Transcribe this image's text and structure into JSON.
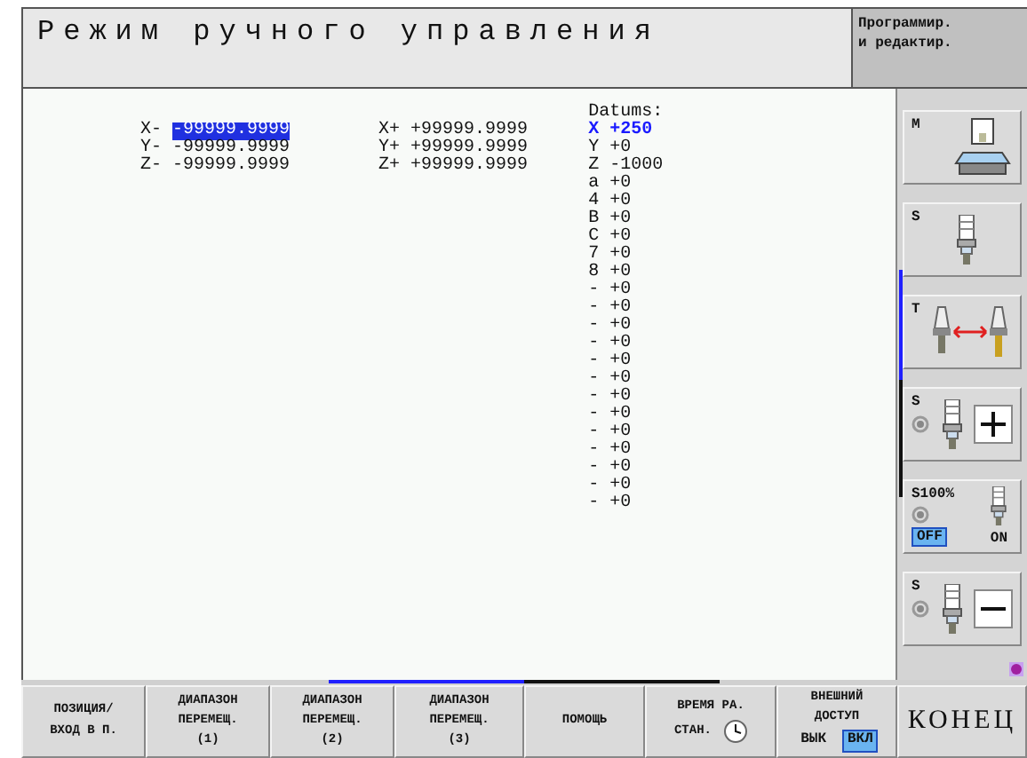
{
  "header": {
    "title": "Режим ручного управления",
    "mode_lines": [
      "Программир.",
      "и редактир."
    ]
  },
  "limits": [
    {
      "minus_label": "X-",
      "min": "-99999.9999",
      "selected": true,
      "plus_label": "X+",
      "max": "+99999.9999"
    },
    {
      "minus_label": "Y-",
      "min": "-99999.9999",
      "selected": false,
      "plus_label": "Y+",
      "max": "+99999.9999"
    },
    {
      "minus_label": "Z-",
      "min": "-99999.9999",
      "selected": false,
      "plus_label": "Z+",
      "max": "+99999.9999"
    }
  ],
  "datums": {
    "title": "Datums:",
    "items": [
      {
        "text": "X +250",
        "selected": true
      },
      {
        "text": "Y +0",
        "selected": false
      },
      {
        "text": "Z -1000",
        "selected": false
      },
      {
        "text": "a +0",
        "selected": false
      },
      {
        "text": "4 +0",
        "selected": false
      },
      {
        "text": "B +0",
        "selected": false
      },
      {
        "text": "C +0",
        "selected": false
      },
      {
        "text": "7 +0",
        "selected": false
      },
      {
        "text": "8 +0",
        "selected": false
      },
      {
        "text": "- +0",
        "selected": false
      },
      {
        "text": "- +0",
        "selected": false
      },
      {
        "text": "- +0",
        "selected": false
      },
      {
        "text": "- +0",
        "selected": false
      },
      {
        "text": "- +0",
        "selected": false
      },
      {
        "text": "- +0",
        "selected": false
      },
      {
        "text": "- +0",
        "selected": false
      },
      {
        "text": "- +0",
        "selected": false
      },
      {
        "text": "- +0",
        "selected": false
      },
      {
        "text": "- +0",
        "selected": false
      },
      {
        "text": "- +0",
        "selected": false
      },
      {
        "text": "- +0",
        "selected": false
      },
      {
        "text": "- +0",
        "selected": false
      }
    ]
  },
  "side_keys": [
    {
      "kind": "machine",
      "label": "M"
    },
    {
      "kind": "spindle",
      "label": "S"
    },
    {
      "kind": "tool_change",
      "label": "T"
    },
    {
      "kind": "spindle_plus",
      "label": "S"
    },
    {
      "kind": "override",
      "label": "S100%",
      "options": [
        {
          "label": "OFF",
          "selected": true
        },
        {
          "label": "ON",
          "selected": false
        }
      ]
    },
    {
      "kind": "spindle_minus",
      "label": "S"
    }
  ],
  "soft_keys": [
    {
      "kind": "text",
      "lines": [
        "ПОЗИЦИЯ/",
        "ВХОД В П."
      ]
    },
    {
      "kind": "text",
      "lines": [
        "ДИАПАЗОН",
        "ПЕРЕМЕЩ.",
        "(1)"
      ]
    },
    {
      "kind": "text",
      "lines": [
        "ДИАПАЗОН",
        "ПЕРЕМЕЩ.",
        "(2)"
      ]
    },
    {
      "kind": "text",
      "lines": [
        "ДИАПАЗОН",
        "ПЕРЕМЕЩ.",
        "(3)"
      ]
    },
    {
      "kind": "text",
      "lines": [
        "ПОМОЩЬ"
      ]
    },
    {
      "kind": "clock",
      "lines": [
        "ВРЕМЯ РА.",
        "СТАН."
      ]
    },
    {
      "kind": "toggle",
      "lines": [
        "ВНЕШНИЙ",
        "ДОСТУП"
      ],
      "options": [
        {
          "label": "ВЫК",
          "selected": false
        },
        {
          "label": "ВКЛ",
          "selected": true
        }
      ]
    },
    {
      "kind": "end",
      "lines": [
        "КОНЕЦ"
      ]
    }
  ]
}
